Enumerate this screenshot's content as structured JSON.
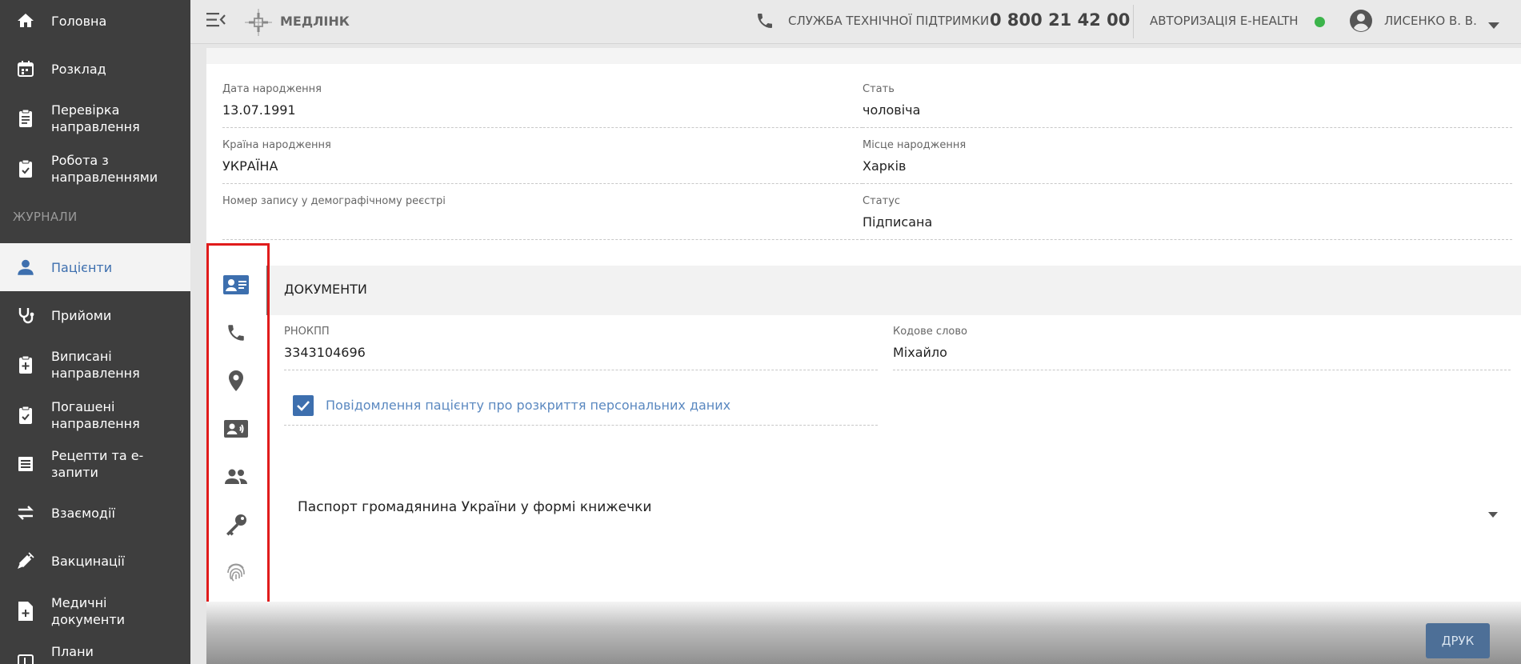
{
  "sidebar": {
    "items": [
      {
        "label": "Головна",
        "icon": "home-icon"
      },
      {
        "label": "Розклад",
        "icon": "calendar-icon"
      },
      {
        "label": "Перевірка\nнаправлення",
        "icon": "clipboard-icon"
      },
      {
        "label": "Робота з\nнаправленнями",
        "icon": "clipboard-check-icon"
      },
      {
        "label": "Пацієнти",
        "icon": "person-icon"
      },
      {
        "label": "Прийоми",
        "icon": "stethoscope-icon"
      },
      {
        "label": "Виписані\nнаправлення",
        "icon": "clipboard-plus-icon"
      },
      {
        "label": "Погашені\nнаправлення",
        "icon": "clipboard-check-icon"
      },
      {
        "label": "Рецепти та е-\nзапити",
        "icon": "list-icon"
      },
      {
        "label": "Взаємодії",
        "icon": "swap-icon"
      },
      {
        "label": "Вакцинації",
        "icon": "syringe-icon"
      },
      {
        "label": "Медичні\nдокументи",
        "icon": "document-plus-icon"
      },
      {
        "label": "Плани",
        "icon": "plan-icon"
      }
    ],
    "section_journals": "ЖУРНАЛИ",
    "active": "Пацієнти"
  },
  "header": {
    "logo_text": "МЕДЛІНК",
    "support_label": "СЛУЖБА ТЕХНІЧНОЇ ПІДТРИМКИ",
    "support_phone": "0 800 21 42 00",
    "ehealth_label": "АВТОРИЗАЦІЯ E-HEALTH",
    "ehealth_status_color": "#3cb44b",
    "user_name": "ЛИСЕНКО В. В."
  },
  "patient": {
    "birth_date_label": "Дата народження",
    "birth_date": "13.07.1991",
    "sex_label": "Стать",
    "sex": "чоловіча",
    "birth_country_label": "Країна народження",
    "birth_country": "УКРАЇНА",
    "birth_place_label": "Місце народження",
    "birth_place": "Харків",
    "demographic_record_label": "Номер запису у демографічному реєстрі",
    "demographic_record": "",
    "status_label": "Статус",
    "status": "Підписана"
  },
  "documents": {
    "title": "ДОКУМЕНТИ",
    "rnokpp_label": "РНОКПП",
    "rnokpp": "3343104696",
    "code_word_label": "Кодове слово",
    "code_word": "Міхайло",
    "consent_label": "Повідомлення пацієнту про розкриття персональних даних",
    "consent_checked": true,
    "document_type": "Паспорт громадянина України у формі книжечки"
  },
  "tabs": [
    "id-card-icon",
    "phone-icon",
    "location-icon",
    "contact-card-icon",
    "people-icon",
    "key-icon",
    "fingerprint-icon"
  ],
  "actions": {
    "print_label": "ДРУК"
  },
  "colors": {
    "accent": "#3d6fae",
    "sidebar_bg": "#3e3e3e",
    "highlight": "#e01b1b"
  }
}
